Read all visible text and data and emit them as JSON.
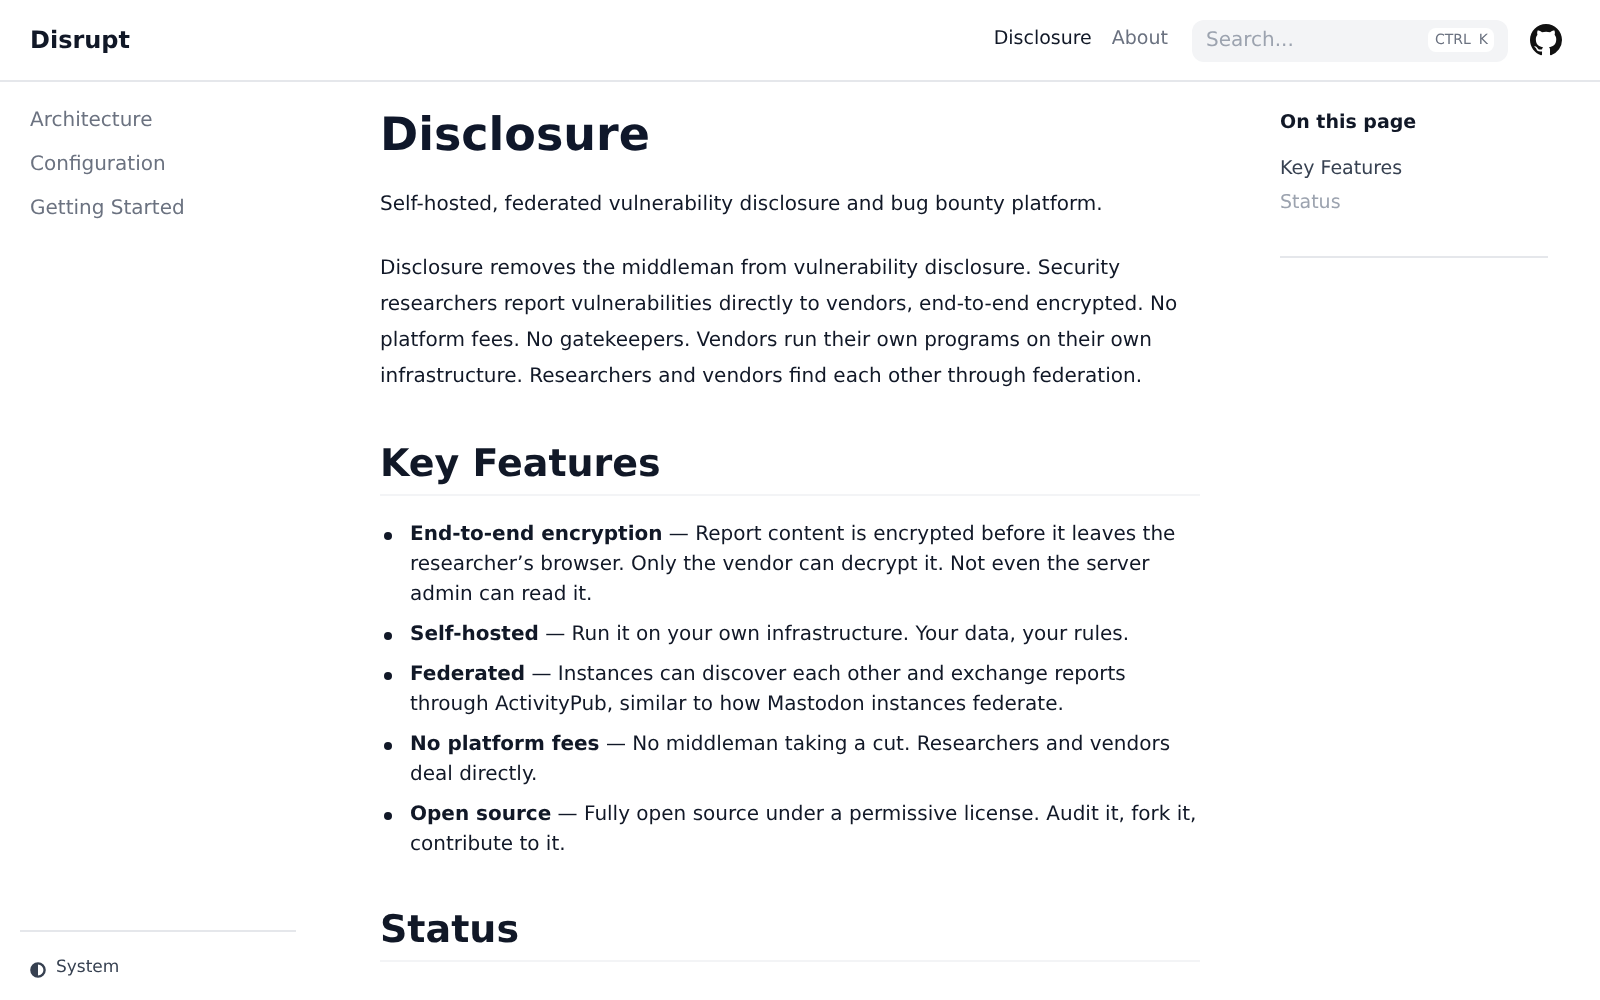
{
  "header": {
    "brand": "Disrupt",
    "nav": [
      {
        "label": "Disclosure",
        "selected": true
      },
      {
        "label": "About",
        "selected": false
      }
    ],
    "search": {
      "placeholder": "Search...",
      "shortcut": [
        "CTRL",
        "K"
      ]
    }
  },
  "sidebar": {
    "items": [
      {
        "label": "Architecture"
      },
      {
        "label": "Configuration"
      },
      {
        "label": "Getting Started"
      }
    ],
    "theme": "System"
  },
  "main": {
    "title": "Disclosure",
    "lead": "Self-hosted, federated vulnerability disclosure and bug bounty platform.",
    "intro": "Disclosure removes the middleman from vulnerability disclosure. Security researchers report vulnerabilities directly to vendors, end-to-end encrypted. No platform fees. No gatekeepers. Vendors run their own programs on their own infrastructure. Researchers and vendors find each other through federation.",
    "sections": [
      {
        "heading": "Key Features",
        "bullets": [
          "**End-to-end encryption** — Report content is encrypted before it leaves the researcher’s browser. Only the vendor can decrypt it. Not even the server admin can read it.",
          "**Self-hosted** — Run it on your own infrastructure. Your data, your rules.",
          "**Federated** — Instances can discover each other and exchange reports through ActivityPub, similar to how Mastodon instances federate.",
          "**No platform fees** — No middleman taking a cut. Researchers and vendors deal directly.",
          "**Open source** — Fully open source under a permissive license. Audit it, fork it, contribute to it."
        ]
      },
      {
        "heading": "Status"
      }
    ]
  },
  "toc": {
    "title": "On this page",
    "items": [
      {
        "label": "Key Features",
        "selected": true
      },
      {
        "label": "Status",
        "selected": false
      }
    ]
  }
}
